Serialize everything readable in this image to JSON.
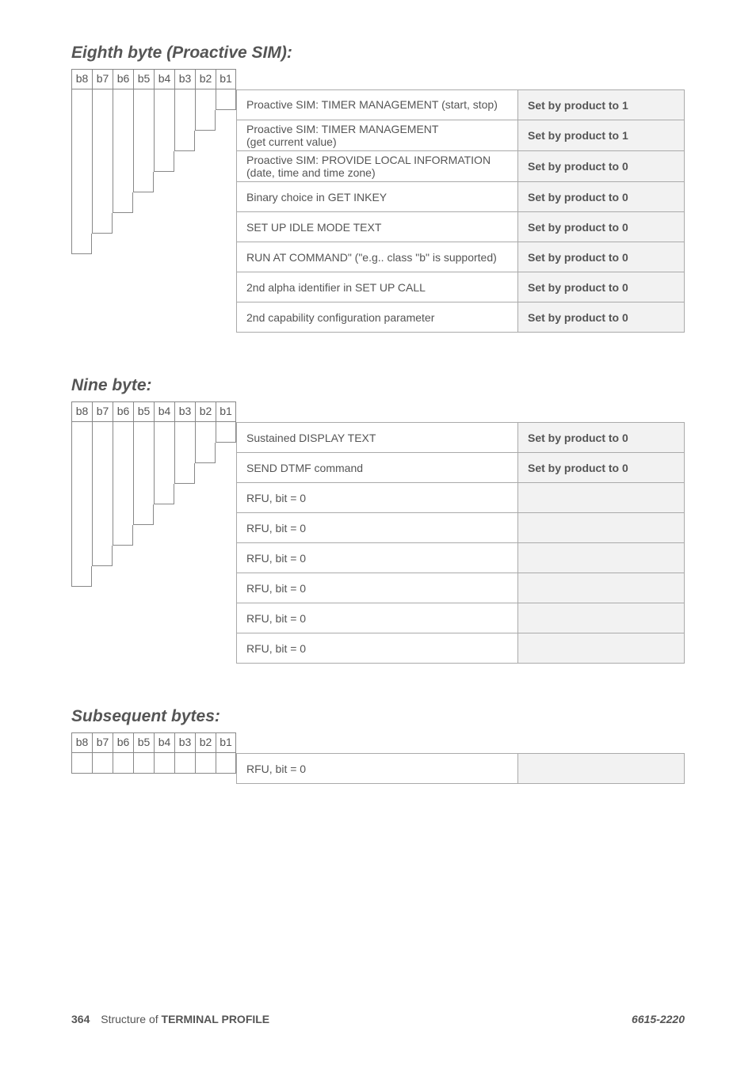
{
  "sections": [
    {
      "heading": "Eighth byte (Proactive SIM):",
      "bits": [
        "b8",
        "b7",
        "b6",
        "b5",
        "b4",
        "b3",
        "b2",
        "b1"
      ],
      "rows": [
        {
          "desc_lines": [
            "Proactive SIM: TIMER MANAGEMENT (start, stop)"
          ],
          "value": "Set by product to 1"
        },
        {
          "desc_lines": [
            "Proactive SIM: TIMER MANAGEMENT",
            "(get current value)"
          ],
          "value": "Set by product to 1"
        },
        {
          "desc_lines": [
            "Proactive SIM: PROVIDE LOCAL INFORMATION",
            "(date, time and time zone)"
          ],
          "value": "Set by product to 0"
        },
        {
          "desc_lines": [
            "Binary choice in GET INKEY"
          ],
          "value": "Set by product to 0"
        },
        {
          "desc_lines": [
            "SET UP IDLE MODE TEXT"
          ],
          "value": "Set by product to 0"
        },
        {
          "desc_lines": [
            "RUN AT COMMAND\" (\"e.g.. class \"b\" is supported)"
          ],
          "value": "Set by product to 0"
        },
        {
          "desc_lines": [
            "2nd alpha identifier in SET UP CALL"
          ],
          "value": "Set by product to 0"
        },
        {
          "desc_lines": [
            "2nd capability configuration parameter"
          ],
          "value": "Set by product to 0"
        }
      ]
    },
    {
      "heading": "Nine byte:",
      "bits": [
        "b8",
        "b7",
        "b6",
        "b5",
        "b4",
        "b3",
        "b2",
        "b1"
      ],
      "rows": [
        {
          "desc_lines": [
            "Sustained DISPLAY TEXT"
          ],
          "value": "Set by product to 0"
        },
        {
          "desc_lines": [
            "SEND DTMF command"
          ],
          "value": "Set by product to 0"
        },
        {
          "desc_lines": [
            "RFU, bit = 0"
          ],
          "value": ""
        },
        {
          "desc_lines": [
            "RFU, bit = 0"
          ],
          "value": ""
        },
        {
          "desc_lines": [
            "RFU, bit = 0"
          ],
          "value": ""
        },
        {
          "desc_lines": [
            "RFU, bit = 0"
          ],
          "value": ""
        },
        {
          "desc_lines": [
            "RFU, bit = 0"
          ],
          "value": ""
        },
        {
          "desc_lines": [
            "RFU, bit = 0"
          ],
          "value": ""
        }
      ]
    },
    {
      "heading": "Subsequent bytes:",
      "bits": [
        "b8",
        "b7",
        "b6",
        "b5",
        "b4",
        "b3",
        "b2",
        "b1"
      ],
      "rows": [
        {
          "desc_lines": [
            "RFU, bit = 0"
          ],
          "value": ""
        }
      ]
    }
  ],
  "footer": {
    "page_number": "364",
    "title_prefix": "Structure of ",
    "title_bold": "TERMINAL PROFILE",
    "right": "6615-2220"
  }
}
